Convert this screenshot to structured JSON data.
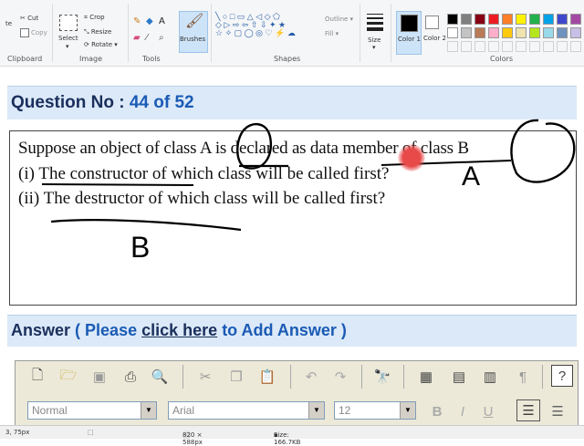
{
  "ribbon": {
    "clipboard_label": "Clipboard",
    "cut": "Cut",
    "copy": "Copy",
    "image_label": "Image",
    "select": "Select",
    "crop": "Crop",
    "resize": "Resize",
    "rotate": "Rotate",
    "tools_label": "Tools",
    "brushes": "Brushes",
    "shapes_label": "Shapes",
    "outline": "Outline",
    "fill": "Fill",
    "size": "Size",
    "color1": "Color 1",
    "color2": "Color 2",
    "colors_label": "Colors",
    "palette_row1": [
      "#000000",
      "#7f7f7f",
      "#880015",
      "#ed1c24",
      "#ff7f27",
      "#fff200",
      "#22b14c",
      "#00a2e8",
      "#3f48cc",
      "#a349a4"
    ],
    "palette_row2": [
      "#ffffff",
      "#c3c3c3",
      "#b97a57",
      "#ffaec9",
      "#ffc90e",
      "#efe4b0",
      "#b5e61d",
      "#99d9ea",
      "#7092be",
      "#c8bfe7"
    ]
  },
  "question": {
    "label": "Question No :",
    "number": "44 of 52",
    "line1": "Suppose an object of class A is declared as data member of class B",
    "line2": "(i) The constructor of which class will be called first?",
    "line3": "(ii) The destructor of which class will be called first?"
  },
  "annotations": {
    "mark_a": "A",
    "mark_b": "B"
  },
  "answer": {
    "label": "Answer",
    "prefix": "( Please",
    "link": "click here",
    "suffix": "to Add Answer )"
  },
  "editor": {
    "style_value": "Normal",
    "font_value": "Arial",
    "size_value": "12"
  },
  "status": {
    "coords": "3, 75px",
    "dimensions": "820 × 588px",
    "filesize": "Size: 166.7KB"
  }
}
